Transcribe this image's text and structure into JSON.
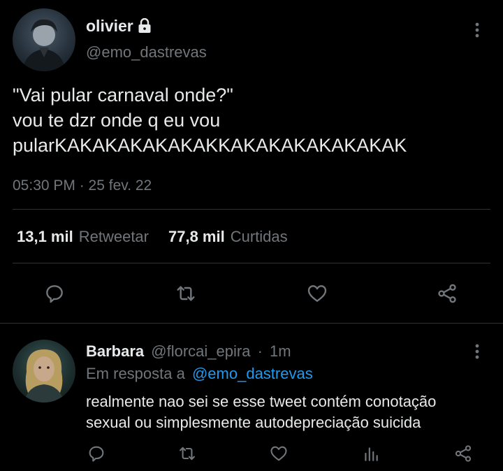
{
  "tweet": {
    "author_name": "olivier",
    "author_handle": "@emo_dastrevas",
    "text_lines": [
      "\"Vai pular carnaval onde?\"",
      "vou te dzr onde q eu vou",
      "pularKAKAKAKAKAKAKKAKAKAKAKAKAKAK"
    ],
    "timestamp": "05:30 PM · 25 fev. 22",
    "retweets_count": "13,1 mil",
    "retweets_label": "Retweetar",
    "likes_count": "77,8 mil",
    "likes_label": "Curtidas",
    "icons": {
      "lock": "lock-icon",
      "more": "more-vertical-icon",
      "reply": "reply-icon",
      "retweet": "retweet-icon",
      "like": "heart-icon",
      "share": "share-icon"
    }
  },
  "reply": {
    "author_name": "Barbara",
    "author_handle": "@florcai_epira",
    "separator": "·",
    "time": "1m",
    "in_reply_prefix": "Em resposta a",
    "in_reply_handle": "@emo_dastrevas",
    "text_lines": [
      "realmente nao sei se esse tweet contém conotação",
      "sexual ou simplesmente autodepreciação suicida"
    ],
    "icons": {
      "reply": "reply-icon",
      "retweet": "retweet-icon",
      "like": "heart-icon",
      "analytics": "analytics-icon",
      "share": "share-icon"
    }
  },
  "colors": {
    "background": "#000000",
    "text": "#e7e9ea",
    "muted": "#71767b",
    "link": "#1d9bf0",
    "divider": "#2f3336"
  }
}
